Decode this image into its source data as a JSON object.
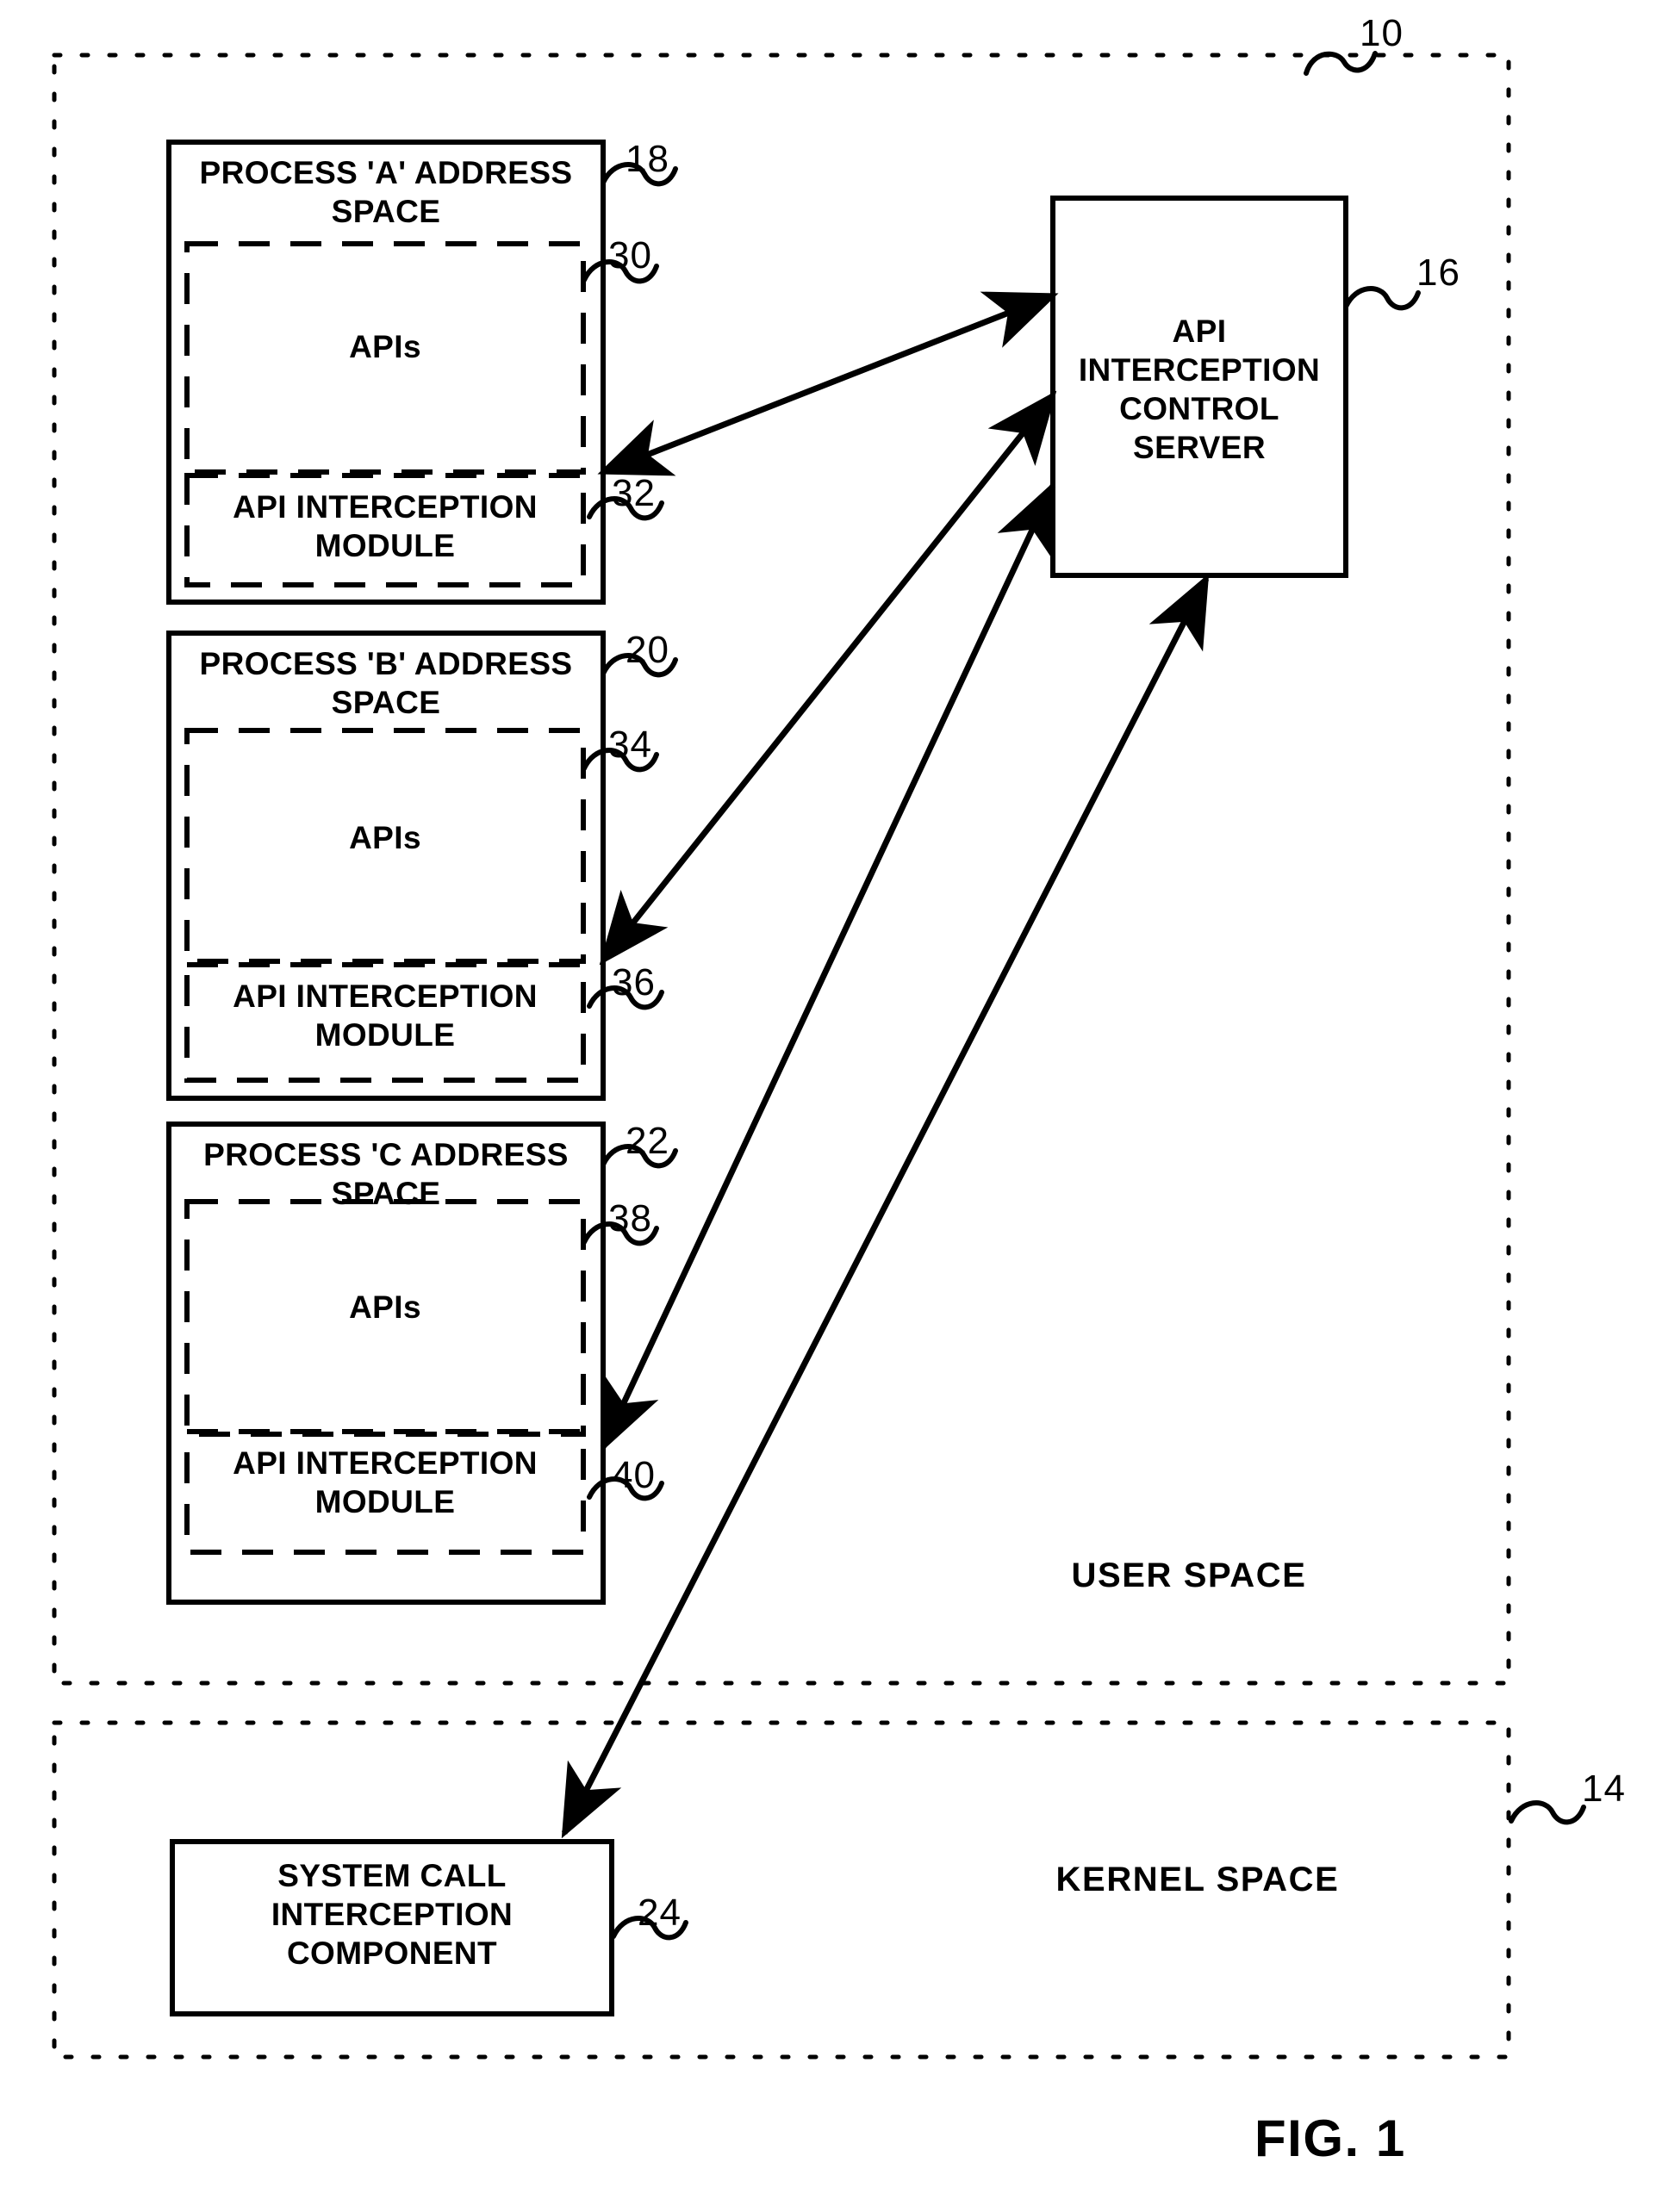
{
  "figure": {
    "label": "FIG. 1",
    "system_ref": "10",
    "kernel_ref": "14"
  },
  "user_space": {
    "label": "USER SPACE"
  },
  "kernel_space": {
    "label": "KERNEL SPACE"
  },
  "server": {
    "title": "API\nINTERCEPTION\nCONTROL\nSERVER",
    "ref": "16"
  },
  "processes": [
    {
      "title": "PROCESS 'A' ADDRESS\nSPACE",
      "ref": "18",
      "apis_label": "APIs",
      "apis_ref": "30",
      "module_label": "API INTERCEPTION\nMODULE",
      "module_ref": "32"
    },
    {
      "title": "PROCESS 'B' ADDRESS\nSPACE",
      "ref": "20",
      "apis_label": "APIs",
      "apis_ref": "34",
      "module_label": "API INTERCEPTION\nMODULE",
      "module_ref": "36"
    },
    {
      "title": "PROCESS 'C ADDRESS\nSPACE",
      "ref": "22",
      "apis_label": "APIs",
      "apis_ref": "38",
      "module_label": "API INTERCEPTION\nMODULE",
      "module_ref": "40"
    }
  ],
  "kernel_component": {
    "title": "SYSTEM CALL\nINTERCEPTION\nCOMPONENT",
    "ref": "24"
  },
  "colors": {
    "ink": "#000000",
    "paper": "#ffffff"
  }
}
